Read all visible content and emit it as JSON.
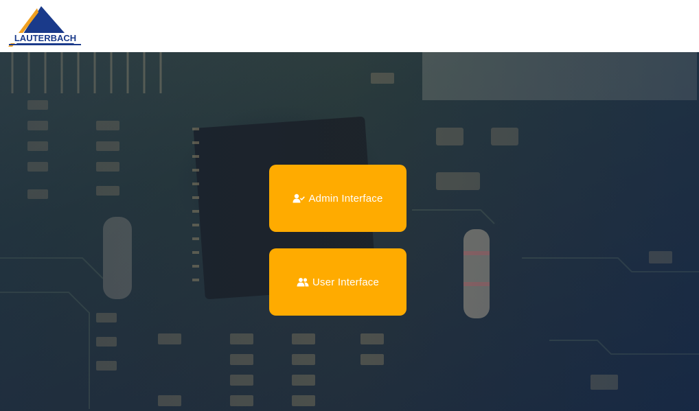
{
  "brand": {
    "logo_text": "LAUTERBACH",
    "colors": {
      "blue": "#1a3a7a",
      "orange": "#f0a020"
    }
  },
  "buttons": {
    "admin": {
      "label": "Admin Interface",
      "icon": "user-check-icon"
    },
    "user": {
      "label": "User Interface",
      "icon": "users-icon"
    }
  },
  "theme": {
    "button_bg": "#ffab00",
    "button_text": "#ffffff"
  }
}
